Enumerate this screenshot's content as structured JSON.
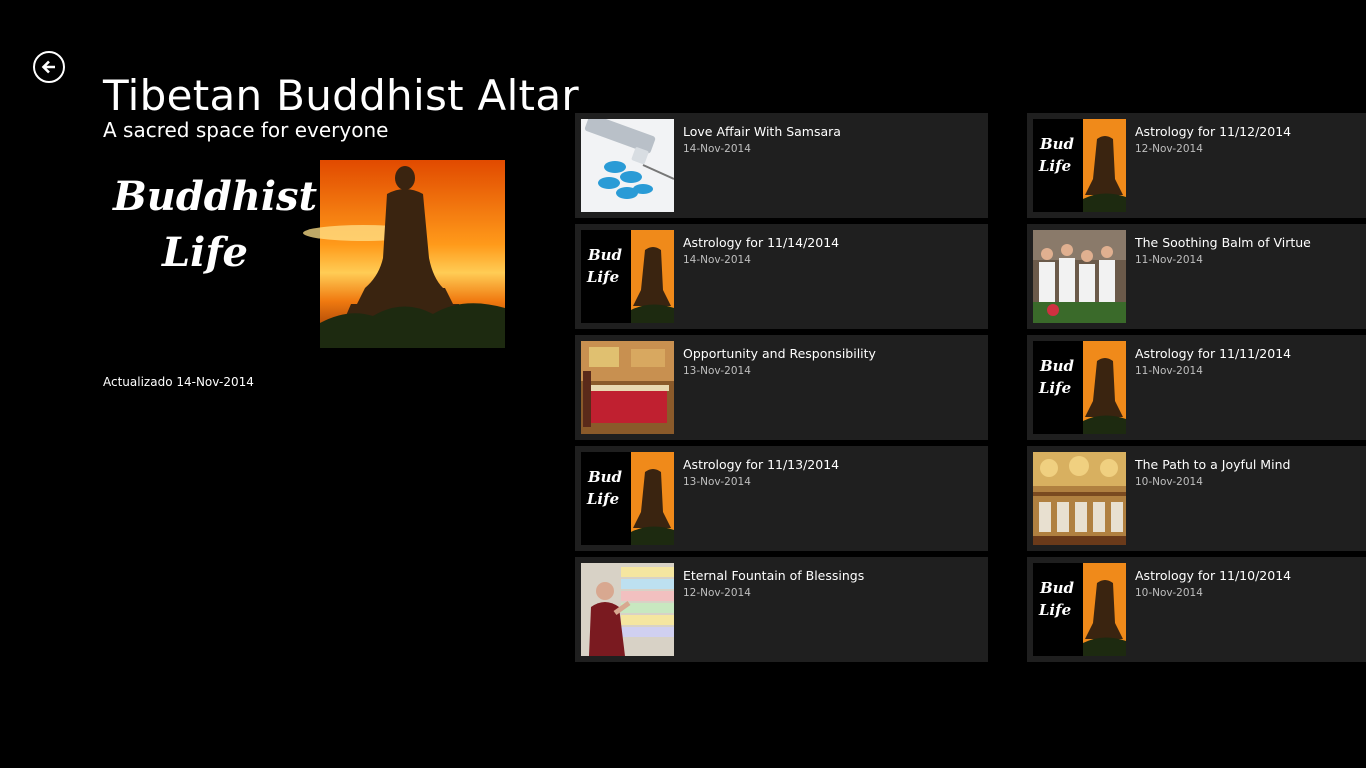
{
  "header": {
    "title": "Tibetan Buddhist Altar",
    "back_icon": "back-arrow-icon"
  },
  "intro": {
    "subtitle": "A sacred space for everyone",
    "logo_text_line1": "Buddhist",
    "logo_text_line2": "Life",
    "updated": "Actualizado 14-Nov-2014"
  },
  "articles": [
    {
      "title": "Love Affair With Samsara",
      "date": "14-Nov-2014",
      "thumb": "pills"
    },
    {
      "title": "Astrology for 11/12/2014",
      "date": "12-Nov-2014",
      "thumb": "buddhist-life"
    },
    {
      "title": "Astrology for 11/14/2014",
      "date": "14-Nov-2014",
      "thumb": "buddhist-life"
    },
    {
      "title": "The Soothing Balm of Virtue",
      "date": "11-Nov-2014",
      "thumb": "group"
    },
    {
      "title": "Opportunity and Responsibility",
      "date": "13-Nov-2014",
      "thumb": "shrine-room"
    },
    {
      "title": "Astrology for 11/11/2014",
      "date": "11-Nov-2014",
      "thumb": "buddhist-life"
    },
    {
      "title": "Astrology for 11/13/2014",
      "date": "13-Nov-2014",
      "thumb": "buddhist-life"
    },
    {
      "title": "The Path to a Joyful Mind",
      "date": "10-Nov-2014",
      "thumb": "altar"
    },
    {
      "title": "Eternal Fountain of Blessings",
      "date": "12-Nov-2014",
      "thumb": "wall"
    },
    {
      "title": "Astrology for 11/10/2014",
      "date": "10-Nov-2014",
      "thumb": "buddhist-life"
    }
  ]
}
